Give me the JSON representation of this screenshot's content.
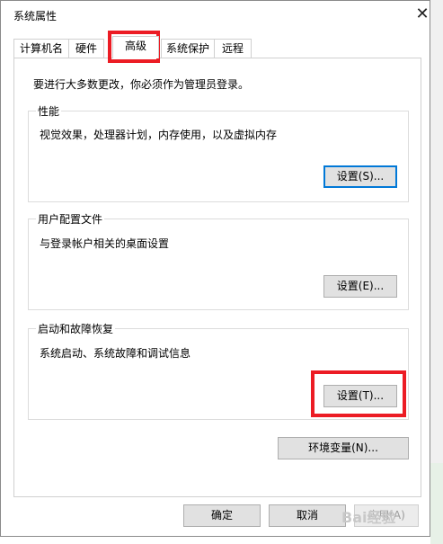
{
  "window": {
    "title": "系统属性",
    "close_glyph": "✕"
  },
  "tabs": [
    {
      "label": "计算机名"
    },
    {
      "label": "硬件"
    },
    {
      "label": "高级"
    },
    {
      "label": "系统保护"
    },
    {
      "label": "远程"
    }
  ],
  "active_tab": "高级",
  "admin_note": "要进行大多数更改，你必须作为管理员登录。",
  "performance": {
    "title": "性能",
    "description": "视觉效果，处理器计划，内存使用，以及虚拟内存",
    "settings_button": "设置(S)..."
  },
  "user_profiles": {
    "title": "用户配置文件",
    "description": "与登录帐户相关的桌面设置",
    "settings_button": "设置(E)..."
  },
  "startup_recovery": {
    "title": "启动和故障恢复",
    "description": "系统启动、系统故障和调试信息",
    "settings_button": "设置(T)..."
  },
  "env_button": "环境变量(N)...",
  "footer": {
    "ok": "确定",
    "cancel": "取消",
    "apply": "应用(A)"
  },
  "watermark": "Bai经验",
  "colors": {
    "highlight": "#ec1c24",
    "focus": "#0078d7",
    "button_bg": "#e1e1e1"
  }
}
